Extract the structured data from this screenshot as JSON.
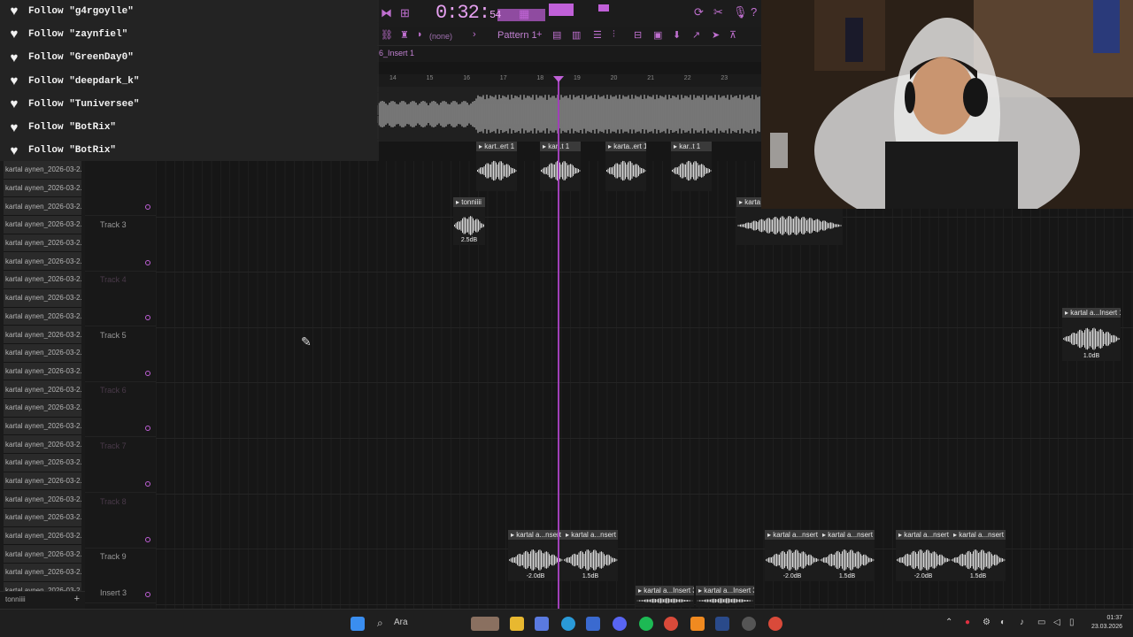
{
  "follows": [
    "Follow \"g4rgoylle\"",
    "Follow \"zaynfiel\"",
    "Follow \"GreenDay0\"",
    "Follow \"deepdark_k\"",
    "Follow \"Tuniversee\"",
    "Follow \"BotRix\"",
    "Follow \"BotRix\""
  ],
  "toolbar": {
    "time_main": "0:32",
    "time_sub": "54",
    "pattern": "Pattern 1",
    "preset": "(none)",
    "insert_label": "6_Insert 1"
  },
  "ruler_ticks": [
    "14",
    "15",
    "16",
    "17",
    "18",
    "19",
    "20",
    "21",
    "22",
    "23"
  ],
  "browser": {
    "item_label": "kartal aynen_2026-03-2...",
    "item_count": 24,
    "bottom_label": "tonniiii"
  },
  "tracks": [
    {
      "name": "",
      "dim": false
    },
    {
      "name": "Track 3",
      "dim": false
    },
    {
      "name": "Track 4",
      "dim": true
    },
    {
      "name": "Track 5",
      "dim": false
    },
    {
      "name": "Track 6",
      "dim": true
    },
    {
      "name": "Track 7",
      "dim": true
    },
    {
      "name": "Track 8",
      "dim": true
    },
    {
      "name": "Track 9",
      "dim": false
    }
  ],
  "insert_track": "Insert 3",
  "clips": {
    "track2": [
      "kart..ert 1",
      "kar..t 1",
      "karta..ert 1",
      "kar..t 1"
    ],
    "track3_a": "tonniiii",
    "track3_a_gain": "2.5dB",
    "track3_b": "karta",
    "track5": "kartal a...Insert 1",
    "track5_gain": "1.0dB",
    "track9": [
      "kartal a...nsert 3",
      "kartal a...nsert 3",
      "kartal a...nsert 3",
      "kartal a...nsert 3",
      "kartal a...nsert 3",
      "kartal a...nsert 3"
    ],
    "track9_gains": [
      "-2.0dB",
      "1.5dB",
      "-2.0dB",
      "1.5dB",
      "-2.0dB",
      "1.5dB"
    ],
    "insert3": [
      "kartal a...Insert 3",
      "kartal a...Insert 3"
    ]
  },
  "taskbar": {
    "search": "Ara",
    "time": "01:37",
    "date": "23.03.2026"
  },
  "colors": {
    "accent": "#c060d8",
    "playhead": "#a040b8"
  }
}
